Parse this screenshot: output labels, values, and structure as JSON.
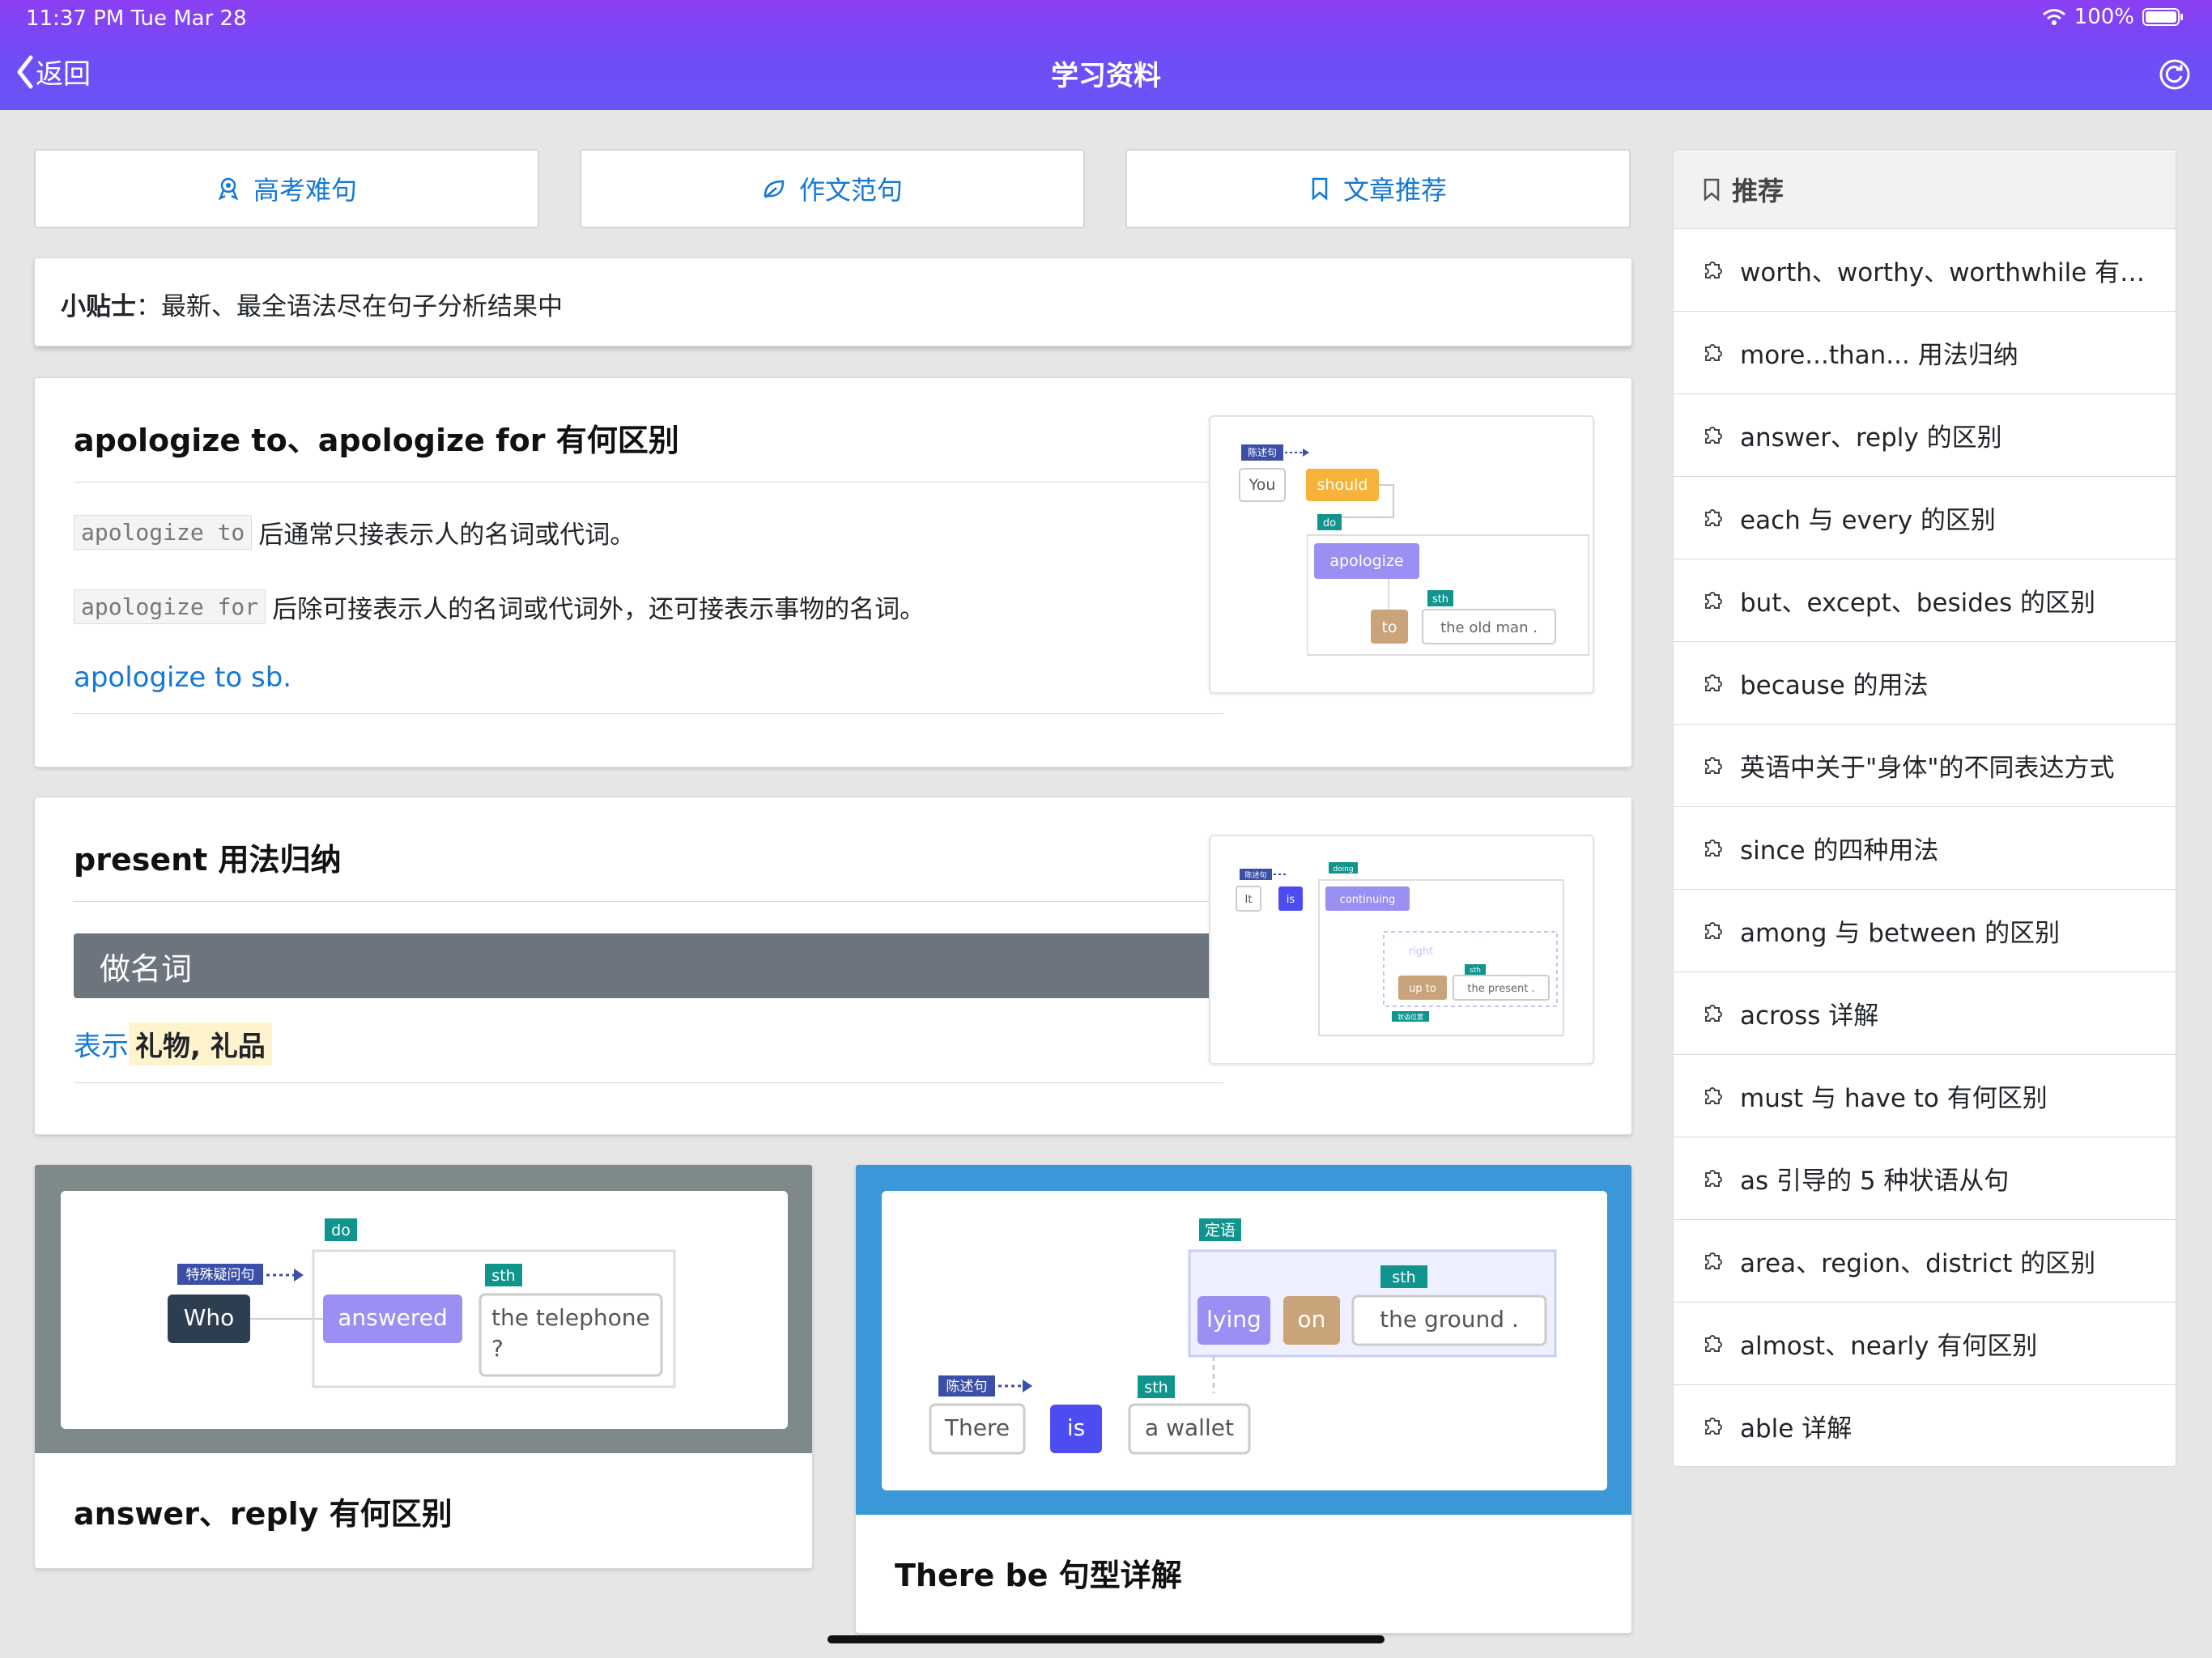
{
  "status_bar": {
    "time_date": "11:37 PM   Tue Mar 28",
    "battery": "100%"
  },
  "header": {
    "back_label": "返回",
    "title": "学习资料"
  },
  "tabs": [
    {
      "label": "高考难句",
      "icon": "rocket-icon"
    },
    {
      "label": "作文范句",
      "icon": "leaf-icon"
    },
    {
      "label": "文章推荐",
      "icon": "bookmark-icon"
    }
  ],
  "tip": {
    "label": "小贴士",
    "sep": "：",
    "text": "最新、最全语法尽在句子分析结果中"
  },
  "card1": {
    "title": "apologize to、apologize for 有何区别",
    "code1": "apologize to",
    "text1": "后通常只接表示人的名词或代词。",
    "code2": "apologize for",
    "text2": "后除可接表示人的名词或代词外，还可接表示事物的名词。",
    "link": "apologize to sb.",
    "diagram": {
      "tag": "陈述句",
      "you": "You",
      "should": "should",
      "do": "do",
      "apologize": "apologize",
      "sth": "sth",
      "to": "to",
      "obj": "the old man ."
    }
  },
  "card2": {
    "title": "present 用法归纳",
    "section": "做名词",
    "meaning_prefix": "表示",
    "meaning": "礼物, 礼品",
    "diagram": {
      "tag": "陈述句",
      "it": "It",
      "is": "is",
      "doing": "doing",
      "continuing": "continuing",
      "right": "right",
      "sth": "sth",
      "upto": "up to",
      "obj": "the present .",
      "adv": "状语位置"
    }
  },
  "card3": {
    "caption": "answer、reply 有何区别",
    "diagram": {
      "tag": "特殊疑问句",
      "who": "Who",
      "do": "do",
      "answered": "answered",
      "sth": "sth",
      "obj1": "the telephone",
      "obj2": "?"
    }
  },
  "card4": {
    "caption": "There be 句型详解",
    "diagram": {
      "tag": "陈述句",
      "there": "There",
      "is": "is",
      "sth": "sth",
      "wallet": "a wallet",
      "attr": "定语",
      "sth2": "sth",
      "lying": "lying",
      "on": "on",
      "ground": "the ground ."
    }
  },
  "sidebar": {
    "header": "推荐",
    "items": [
      "worth、worthy、worthwhile 有何区别",
      "more...than... 用法归纳",
      "answer、reply 的区别",
      "each 与 every 的区别",
      "but、except、besides 的区别",
      "because 的用法",
      "英语中关于\"身体\"的不同表达方式",
      "since 的四种用法",
      "among 与 between 的区别",
      "across 详解",
      "must 与 have to 有何区别",
      "as 引导的 5 种状语从句",
      "area、region、district 的区别",
      "almost、nearly 有何区别",
      "able 详解"
    ]
  },
  "colors": {
    "header_purple": "#7a4cf5",
    "link_blue": "#1478d4",
    "section_gray": "#6c757d",
    "highlight": "#fff3cd"
  }
}
